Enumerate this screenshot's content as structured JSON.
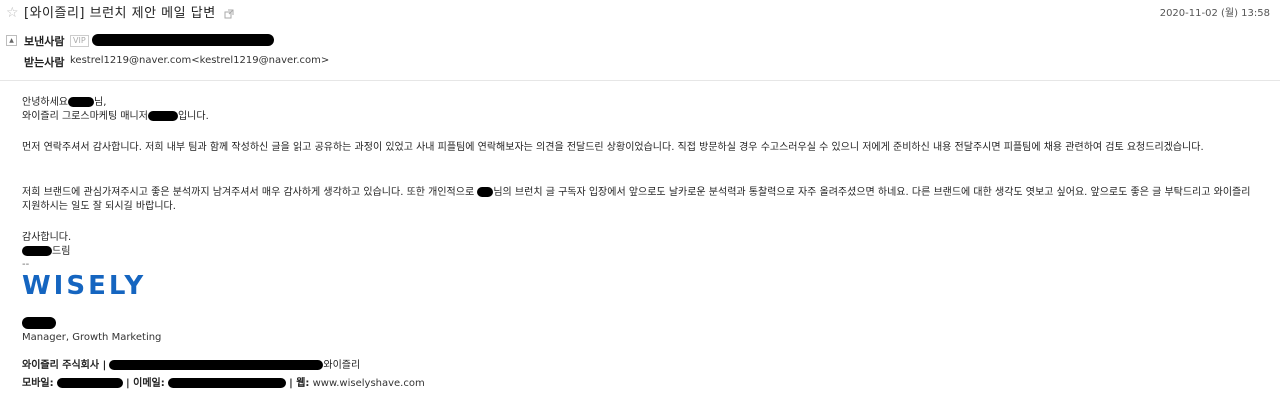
{
  "header": {
    "subject": "[와이즐리] 브런치 제안 메일 답변",
    "date": "2020-11-02 (월) 13:58",
    "from_label": "보낸사람",
    "vip_badge": "VIP",
    "to_label": "받는사람",
    "to_value": "kestrel1219@naver.com<kestrel1219@naver.com>"
  },
  "body": {
    "greeting_prefix": "안녕하세요",
    "greeting_suffix": "님,",
    "intro_prefix": "와이즐리 그로스마케팅 매니저",
    "intro_suffix": "입니다.",
    "para1": "먼저 연락주셔서 감사합니다. 저희 내부 팀과 함께 작성하신 글을 읽고 공유하는 과정이 있었고 사내 피플팀에 연락해보자는 의견을 전달드린 상황이었습니다. 직접 방문하실 경우 수고스러우실 수 있으니 저에게 준비하신 내용 전달주시면 피플팀에 채용 관련하여 검토 요청드리겠습니다.",
    "para2_a": "저희 브랜드에 관심가져주시고 좋은 분석까지 남겨주셔서 매우 감사하게 생각하고 있습니다. 또한 개인적으로",
    "para2_b": "님의 브런치 글 구독자 입장에서 앞으로도 날카로운 분석력과 통찰력으로 자주 올려주셨으면 하네요. 다른 브랜드에 대한 생각도 엿보고 싶어요. 앞으로도 좋은 글 부탁드리고 와이즐리 지원하시는 일도 잘 되시길 바랍니다.",
    "closing": "감사합니다.",
    "sign_suffix": "드림",
    "dashes": "--"
  },
  "signature": {
    "logo_text": "WISELY",
    "title": "Manager, Growth Marketing",
    "company": "와이즐리 주식회사 |",
    "company_tail": "와이즐리",
    "mobile_label": "모바일:",
    "email_label": "| 이메일:",
    "web_label": "| 웹:",
    "web_value": "www.wiselyshave.com"
  }
}
